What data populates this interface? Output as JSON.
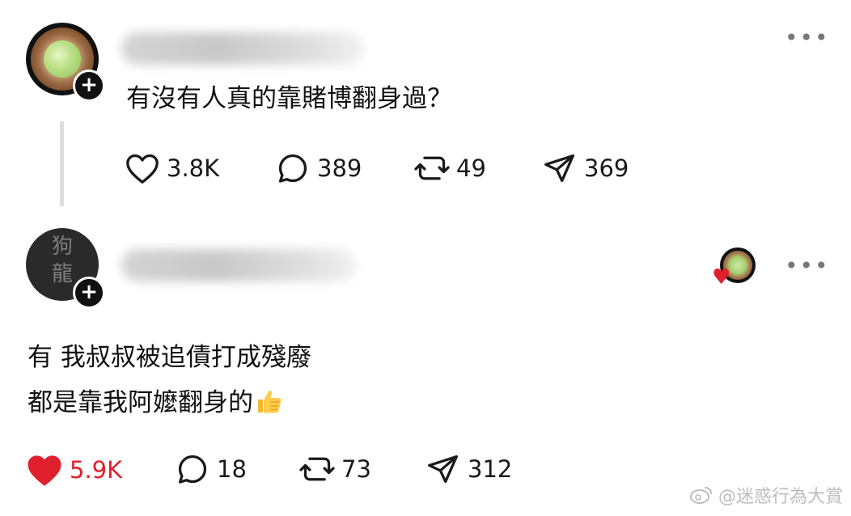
{
  "post": {
    "text": "有沒有人真的靠賭博翻身過？",
    "stats": {
      "likes": "3.8K",
      "replies": "389",
      "reposts": "49",
      "shares": "369"
    }
  },
  "reply": {
    "avatar_seal": [
      "狗",
      "龍"
    ],
    "text_line1": "有 我叔叔被追債打成殘廢",
    "text_line2": "都是靠我阿嬤翻身的",
    "emoji": "thumbs-up",
    "stats": {
      "likes": "5.9K",
      "replies": "18",
      "reposts": "73",
      "shares": "312"
    },
    "liked": true
  },
  "icons": {
    "more": "more-horizontal-icon",
    "plus": "plus-icon",
    "heart": "heart-icon",
    "comment": "comment-icon",
    "repost": "repost-icon",
    "share": "send-icon"
  },
  "colors": {
    "liked": "#e0202c",
    "text": "#111111",
    "muted": "#777777"
  },
  "watermark": "@迷惑行為大賞"
}
